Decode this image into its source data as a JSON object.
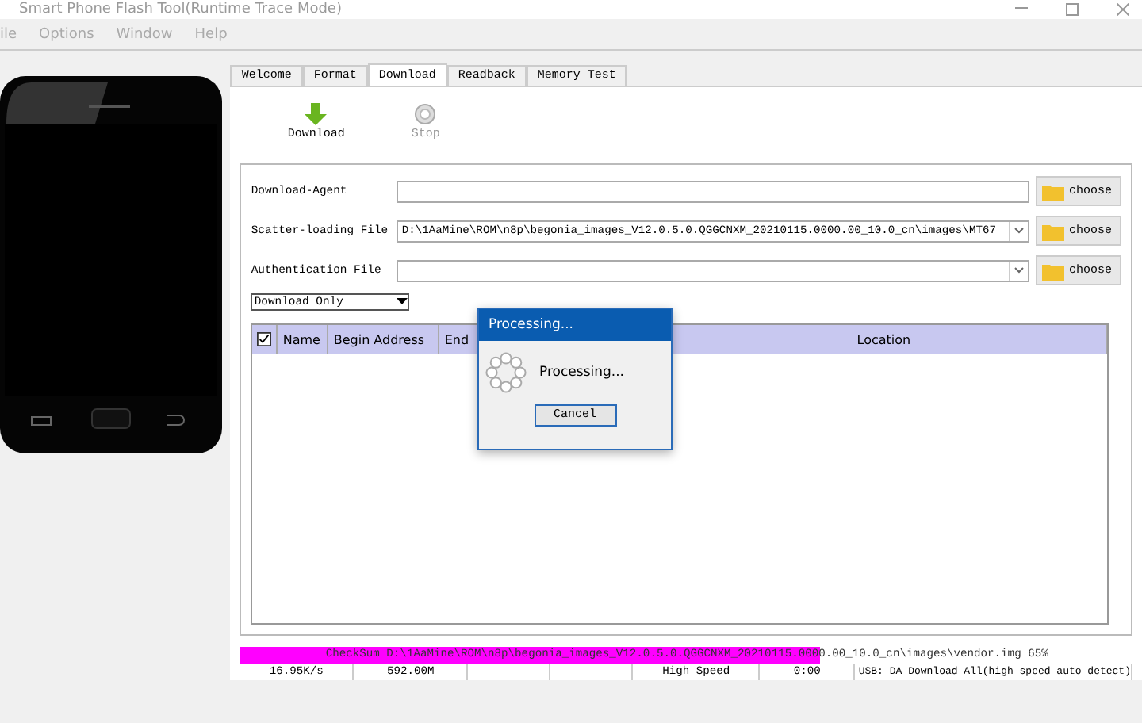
{
  "window": {
    "title": "Smart Phone Flash Tool(Runtime Trace Mode)"
  },
  "menu": [
    "ile",
    "Options",
    "Window",
    "Help"
  ],
  "tabs": [
    {
      "label": "Welcome",
      "selected": false
    },
    {
      "label": "Format",
      "selected": false
    },
    {
      "label": "Download",
      "selected": true
    },
    {
      "label": "Readback",
      "selected": false
    },
    {
      "label": "Memory Test",
      "selected": false
    }
  ],
  "toolbar": [
    {
      "label": "Download",
      "kind": "download",
      "disabled": false
    },
    {
      "label": "Stop",
      "kind": "stop",
      "disabled": true
    }
  ],
  "fields": [
    {
      "label": "Download-Agent",
      "kind": "input",
      "button": "choose"
    },
    {
      "label": "Scatter-loading File",
      "kind": "combo",
      "value": "D:\\1AaMine\\ROM\\n8p\\begonia_images_V12.0.5.0.QGGCNXM_20210115.0000.00_10.0_cn\\images\\MT67",
      "button": "choose"
    },
    {
      "label": "Authentication File",
      "kind": "combo",
      "button": "choose"
    }
  ],
  "mode": {
    "value": "Download Only"
  },
  "table": {
    "all_checked": true,
    "columns": [
      "Name",
      "Begin Address",
      "End",
      "Location"
    ]
  },
  "dialog": {
    "title": "Processing...",
    "message": "Processing...",
    "button": "Cancel"
  },
  "progress": {
    "text": "CheckSum D:\\1AaMine\\ROM\\n8p\\begonia_images_V12.0.5.0.QGGCNXM_20210115.0000.00_10.0_cn\\images\\vendor.img 65%",
    "level": 0.65
  },
  "status_bar": [
    {
      "kind": "text",
      "text": "16.95K/s"
    },
    {
      "kind": "text",
      "text": "592.00M"
    },
    {
      "kind": "blank"
    },
    {
      "kind": "blank"
    },
    {
      "kind": "text",
      "text": "High Speed"
    },
    {
      "kind": "text",
      "text": "0:00"
    },
    {
      "kind": "text",
      "text": "USB: DA Download All(high speed auto detect)"
    }
  ]
}
